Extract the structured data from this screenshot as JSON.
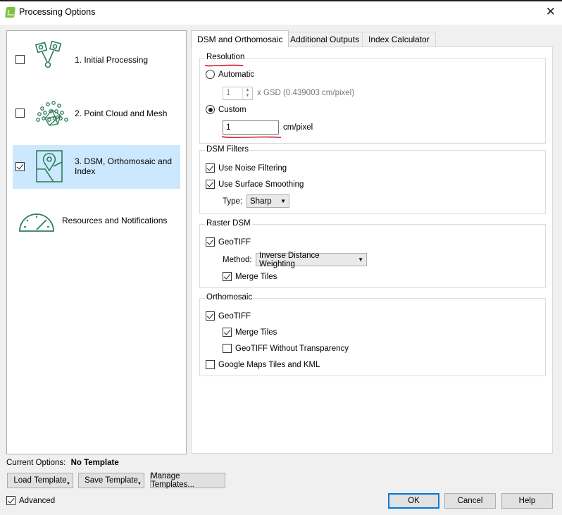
{
  "window": {
    "title": "Processing Options",
    "close_glyph": "✕"
  },
  "steps": [
    {
      "label": "1. Initial Processing",
      "checked": false,
      "icon": "initial-processing-icon"
    },
    {
      "label": "2. Point Cloud and Mesh",
      "checked": false,
      "icon": "point-cloud-icon"
    },
    {
      "label": "3. DSM, Orthomosaic and Index",
      "checked": true,
      "icon": "map-pin-icon",
      "selected": true
    },
    {
      "label": "Resources and Notifications",
      "icon": "gauge-icon"
    }
  ],
  "tabs": [
    {
      "label": "DSM and Orthomosaic",
      "active": true
    },
    {
      "label": "Additional Outputs"
    },
    {
      "label": "Index Calculator"
    }
  ],
  "resolution": {
    "title": "Resolution",
    "automatic_label": "Automatic",
    "gsd_value": "1",
    "gsd_suffix": "x GSD (0.439003 cm/pixel)",
    "custom_label": "Custom",
    "custom_value": "1",
    "custom_unit": "cm/pixel",
    "selected": "custom"
  },
  "dsm_filters": {
    "title": "DSM Filters",
    "noise_label": "Use Noise Filtering",
    "smoothing_label": "Use Surface Smoothing",
    "type_label": "Type:",
    "type_value": "Sharp"
  },
  "raster_dsm": {
    "title": "Raster DSM",
    "geotiff_label": "GeoTIFF",
    "method_label": "Method:",
    "method_value": "Inverse Distance Weighting",
    "merge_label": "Merge Tiles"
  },
  "orthomosaic": {
    "title": "Orthomosaic",
    "geotiff_label": "GeoTIFF",
    "merge_label": "Merge Tiles",
    "no_transparency_label": "GeoTIFF Without Transparency",
    "google_label": "Google Maps Tiles and KML"
  },
  "footer": {
    "current_options_label": "Current Options:",
    "current_options_value": "No Template",
    "load_template": "Load Template",
    "save_template": "Save Template",
    "manage_templates": "Manage Templates...",
    "advanced_label": "Advanced",
    "ok": "OK",
    "cancel": "Cancel",
    "help": "Help"
  },
  "colors": {
    "accent": "#0078d7",
    "selection": "#cce8ff",
    "brand_green": "#2e7d5b",
    "annotation_red": "#d0021b"
  }
}
